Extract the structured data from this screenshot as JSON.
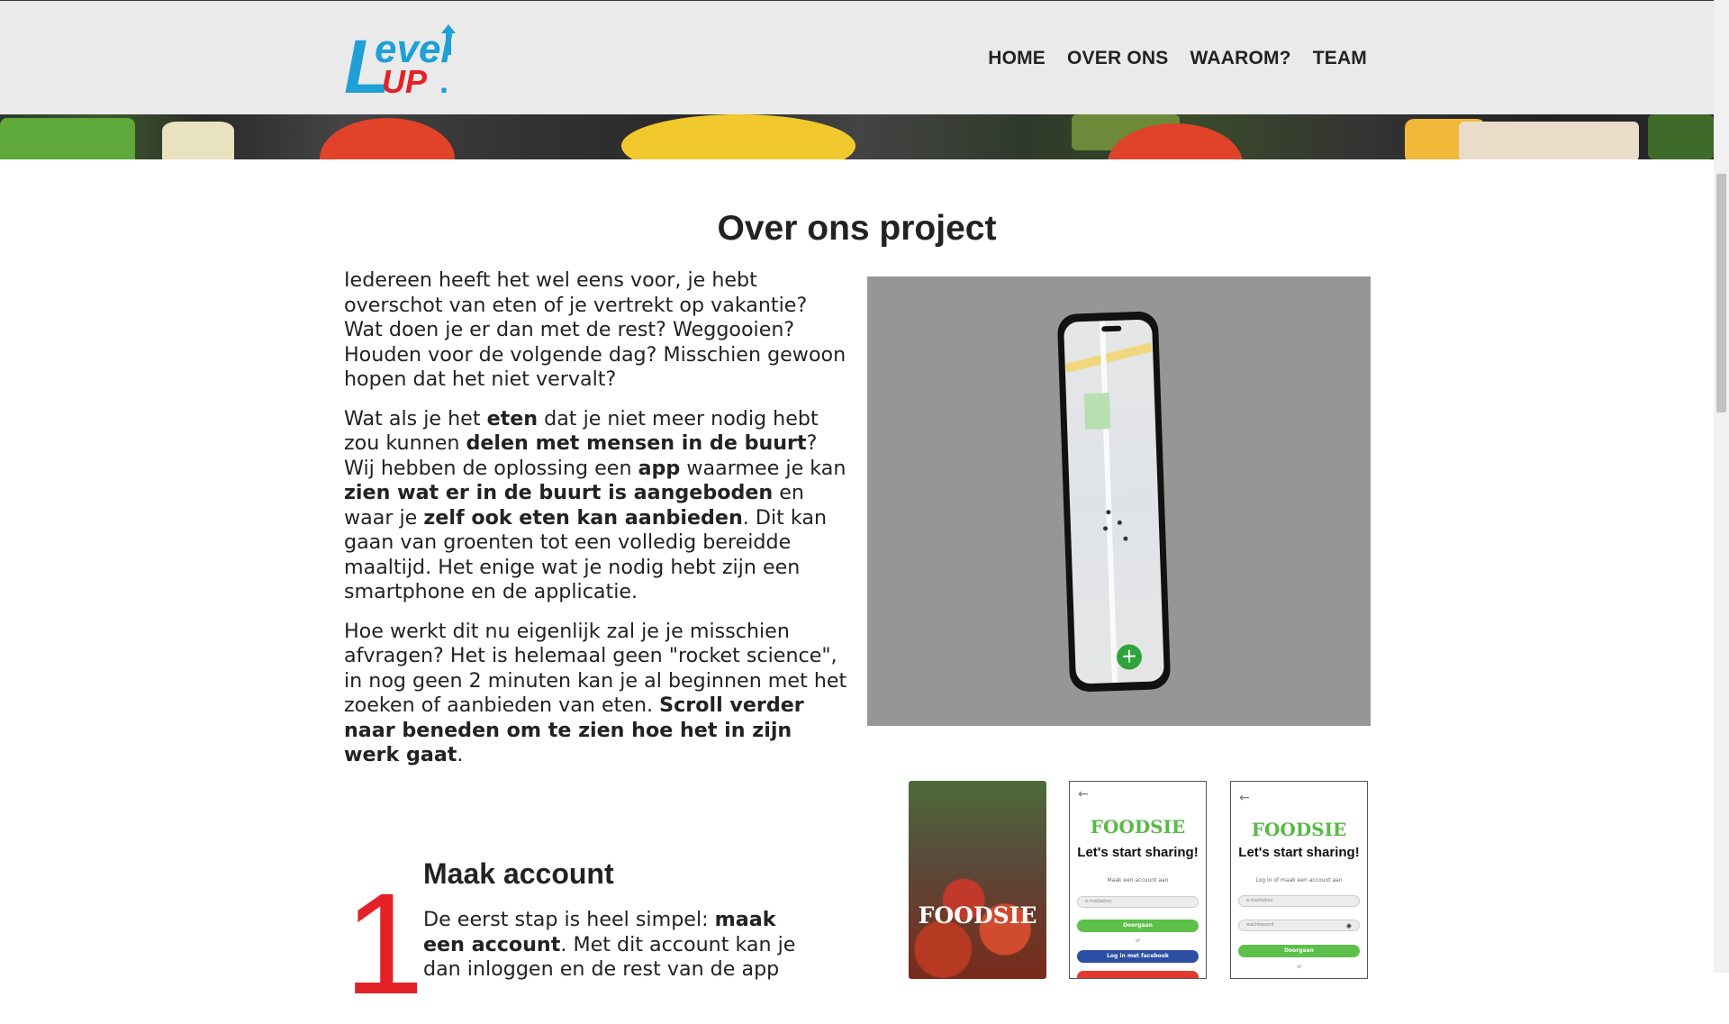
{
  "header": {
    "logo": {
      "line1": "evel",
      "letter": "L",
      "line2": "UP",
      "dot": "."
    },
    "nav": [
      {
        "label": "HOME"
      },
      {
        "label": "OVER ONS"
      },
      {
        "label": "WAAROM?"
      },
      {
        "label": "TEAM"
      }
    ]
  },
  "main": {
    "title": "Over ons project",
    "intro_p1": "Iedereen heeft het wel eens voor, je hebt overschot van eten of je vertrekt op vakantie? Wat doen je er dan met de rest? Weggooien? Houden voor de volgende dag? Misschien gewoon hopen dat het niet vervalt?",
    "intro_p2": {
      "t1": "Wat als je het ",
      "b1": "eten",
      "t2": " dat je niet meer nodig hebt zou kunnen ",
      "b2": "delen met mensen in de buurt",
      "t3": "? Wij hebben de oplossing een ",
      "b3": "app",
      "t4": " waarmee je kan ",
      "b4": "zien wat er in de buurt is aangeboden",
      "t5": " en waar je ",
      "b5": "zelf ook eten kan aanbieden",
      "t6": ". Dit kan gaan van groenten tot een volledig bereidde maaltijd. Het enige wat je nodig hebt zijn een smartphone en de applicatie."
    },
    "intro_p3": {
      "t1": "Hoe werkt dit nu eigenlijk zal je je misschien afvragen? Het is helemaal geen \"rocket science\", in nog geen 2 minuten kan je al beginnen met het zoeken of aanbieden van eten. ",
      "b1": "Scroll verder naar beneden om te zien hoe het in zijn werk gaat",
      "t2": "."
    },
    "phone_fab": "+"
  },
  "step1": {
    "number": "1",
    "title": "Maak account",
    "text_t1": "De eerst stap is heel simpel: ",
    "text_b1": "maak een account",
    "text_t2": ". Met dit account kan je dan inloggen en de rest van de app"
  },
  "screens": {
    "splash_logo": "FOODSIE",
    "app_logo": "FOODSIE",
    "title": "Let's start sharing!",
    "s2_sub": "Maak een account aan",
    "s2_email": "e-mailadres",
    "s2_continue": "Doorgaan",
    "s2_of": "of",
    "s2_facebook": "Log in met facebook",
    "s3_sub": "Log in of maak een account aan",
    "s3_email": "e-mailadres",
    "s3_password": "wachtwoord",
    "s3_continue": "Doorgaan",
    "s3_of": "of"
  },
  "colors": {
    "accent_red": "#e32127",
    "logo_blue": "#1e9fd6",
    "foodsie_green": "#58b947",
    "header_bg": "#eaeaea"
  }
}
